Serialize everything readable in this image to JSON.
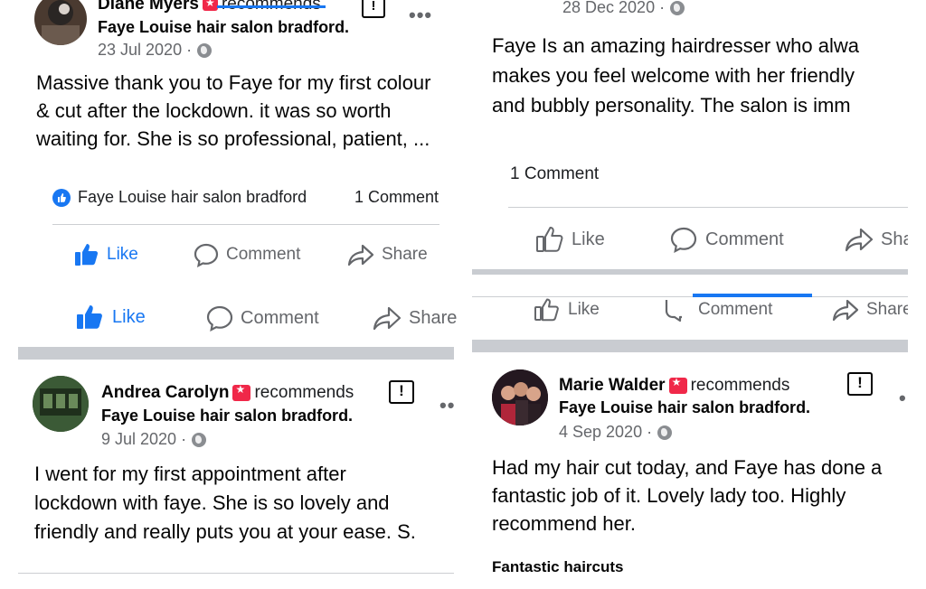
{
  "colors": {
    "accent": "#1877f2",
    "badge": "#f02849",
    "meta": "#65676b",
    "separator": "#c9ccd1"
  },
  "left": {
    "post1": {
      "author": "Diane Myers",
      "recommends": "recommends",
      "page": "Faye Louise hair salon bradford.",
      "date": "23 Jul 2020 ·",
      "body": [
        "Massive thank you to Faye for my first colour",
        "& cut after the lockdown. it was so worth",
        "waiting for. She is so professional, patient, ..."
      ],
      "reaction_label": "Faye Louise hair salon bradford",
      "comment_count": "1 Comment",
      "actions": {
        "like": "Like",
        "comment": "Comment",
        "share": "Share"
      },
      "actions2": {
        "like": "Like",
        "comment": "Comment",
        "share": "Share"
      }
    },
    "post2": {
      "author": "Andrea Carolyn",
      "recommends": "recommends",
      "page": "Faye Louise hair salon bradford.",
      "date": "9 Jul 2020 ·",
      "body": [
        "I went for my first appointment after",
        "lockdown with faye.  She is so lovely and",
        "friendly and really puts you at your ease.  S."
      ]
    }
  },
  "right": {
    "post1": {
      "date": "28 Dec 2020 ·",
      "body": [
        "Faye Is an amazing hairdresser who alwa",
        "makes you feel welcome with her friendly",
        "and bubbly personality. The salon is imm"
      ],
      "comment_count": "1 Comment",
      "actions": {
        "like": "Like",
        "comment": "Comment",
        "share": "Sha"
      },
      "actions2": {
        "like": "Like",
        "comment": "Comment",
        "share": "Share"
      }
    },
    "post2": {
      "author": "Marie Walder",
      "recommends": "recommends",
      "page": "Faye Louise hair salon bradford.",
      "date": "4 Sep 2020 ·",
      "body": [
        "Had my hair cut today, and Faye has done a",
        "fantastic job of it. Lovely lady too. Highly",
        "recommend her."
      ],
      "tag": "Fantastic haircuts"
    }
  }
}
